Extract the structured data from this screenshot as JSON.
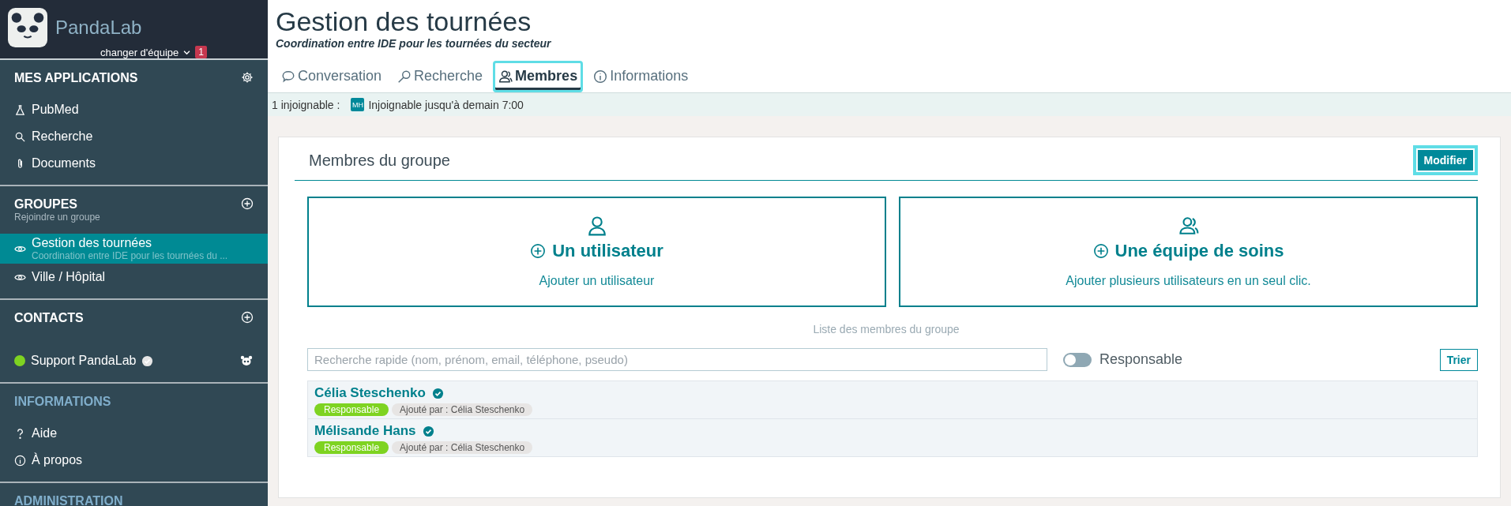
{
  "sidebar": {
    "app_name": "PandaLab",
    "team_switch": "changer d'équipe",
    "team_badge": "1",
    "sections": [
      {
        "title": "MES APPLICATIONS",
        "dimmed": false,
        "items": [
          {
            "label": "PubMed",
            "selected": false
          },
          {
            "label": "Recherche",
            "selected": false
          },
          {
            "label": "Documents",
            "selected": false
          }
        ]
      },
      {
        "title": "GROUPES",
        "subtitle": "Rejoindre un groupe",
        "dimmed": false,
        "items": [
          {
            "label": "Gestion des tournées",
            "subtitle": "Coordination entre IDE pour les tournées du ...",
            "selected": true
          },
          {
            "label": "Ville / Hôpital",
            "selected": false
          }
        ]
      },
      {
        "title": "CONTACTS",
        "dimmed": false,
        "items": [
          {
            "label": "Support PandaLab",
            "selected": false,
            "color": "#7ed321"
          }
        ]
      },
      {
        "title": "INFORMATIONS",
        "dimmed": true,
        "items": [
          {
            "label": "Aide",
            "selected": false
          },
          {
            "label": "À propos",
            "selected": false
          }
        ]
      },
      {
        "title": "ADMINISTRATION",
        "dimmed": true
      }
    ]
  },
  "header": {
    "title": "Gestion des tournées",
    "subtitle": "Coordination entre IDE pour les tournées du secteur"
  },
  "tabs": [
    {
      "label": "Conversation",
      "selected": false,
      "highlighted": false
    },
    {
      "label": "Recherche",
      "selected": false,
      "highlighted": false
    },
    {
      "label": "Membres",
      "selected": true,
      "highlighted": true
    },
    {
      "label": "Informations",
      "selected": false,
      "highlighted": false
    }
  ],
  "status_bar": {
    "label": "1 injoignable :",
    "avatar": "MH",
    "text": "Injoignable jusqu'à demain 7:00"
  },
  "panel": {
    "title": "Membres du groupe",
    "edit_button": {
      "label": "Modifier",
      "highlighted": true
    },
    "add_cards": [
      {
        "title": "Un utilisateur",
        "text": "Ajouter un utilisateur"
      },
      {
        "title": "Une équipe de soins",
        "text": "Ajouter plusieurs utilisateurs en un seul clic."
      }
    ],
    "list_title": "Liste des membres du groupe",
    "search": {
      "placeholder": "Recherche rapide (nom, prénom, email, téléphone, pseudo)"
    },
    "filter_toggle": {
      "label": "Responsable",
      "on": false
    },
    "sort_button": "Trier",
    "members": [
      {
        "name": "Célia Steschenko",
        "role": "Responsable",
        "added_by": "Ajouté par : Célia Steschenko"
      },
      {
        "name": "Mélisande Hans",
        "role": "Responsable",
        "added_by": "Ajouté par : Célia Steschenko"
      }
    ]
  }
}
